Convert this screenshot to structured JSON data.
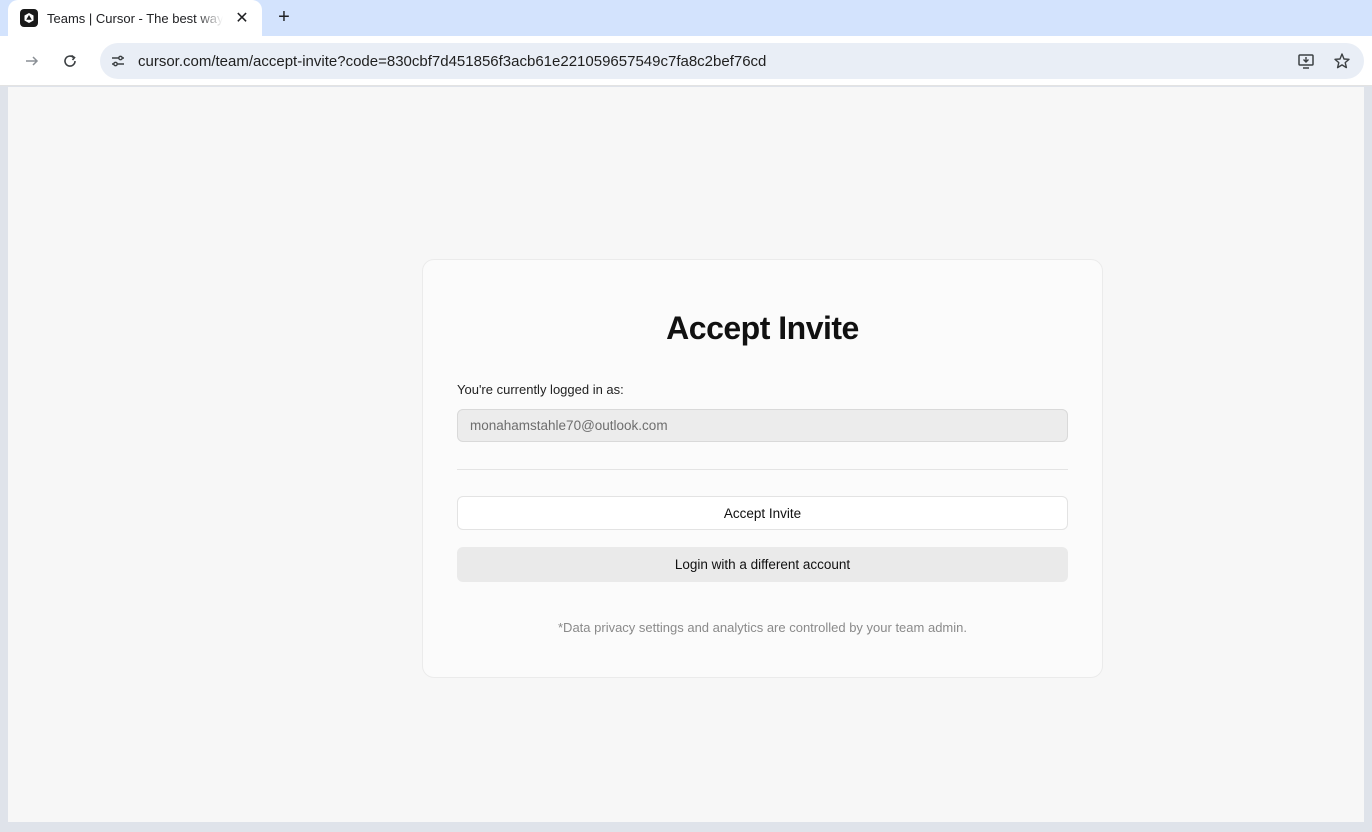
{
  "browser": {
    "tab": {
      "title": "Teams | Cursor - The best way to code with AI",
      "close_symbol": "✕"
    },
    "new_tab_symbol": "+",
    "url": "cursor.com/team/accept-invite?code=830cbf7d451856f3acb61e221059657549c7fa8c2bef76cd",
    "icons": {
      "forward": "forward-arrow-icon",
      "reload": "reload-icon",
      "site_info": "tune-icon",
      "install": "install-app-icon",
      "bookmark": "star-icon"
    }
  },
  "page": {
    "title": "Accept Invite",
    "logged_in_label": "You're currently logged in as:",
    "email": "monahamstahle70@outlook.com",
    "accept_button": "Accept Invite",
    "login_different_button": "Login with a different account",
    "footnote": "*Data privacy settings and analytics are controlled by your team admin."
  }
}
